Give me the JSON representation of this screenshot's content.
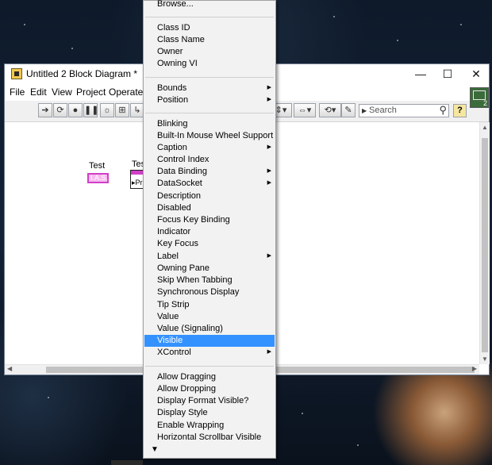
{
  "window": {
    "title": "Untitled 2 Block Diagram *",
    "controls": {
      "minimize": "—",
      "maximize": "☐",
      "close": "✕"
    }
  },
  "menubar": [
    "File",
    "Edit",
    "View",
    "Project",
    "Operate"
  ],
  "toolbar": {
    "search_placeholder": "Search",
    "help_label": "?",
    "vi_icon_number": "2"
  },
  "diagram": {
    "node1_label": "Test",
    "node1_ref_text": "I.A.S.",
    "node2_label": "Tes",
    "node2_prop_text": "▸Pr"
  },
  "context_menu": {
    "top_item": "Browse...",
    "group1": [
      "Class ID",
      "Class Name",
      "Owner",
      "Owning VI"
    ],
    "group2": [
      {
        "label": "Bounds",
        "submenu": true
      },
      {
        "label": "Position",
        "submenu": true
      }
    ],
    "group3": [
      {
        "label": "Blinking",
        "submenu": false
      },
      {
        "label": "Built-In Mouse Wheel Support",
        "submenu": false
      },
      {
        "label": "Caption",
        "submenu": true
      },
      {
        "label": "Control Index",
        "submenu": false
      },
      {
        "label": "Data Binding",
        "submenu": true
      },
      {
        "label": "DataSocket",
        "submenu": true
      },
      {
        "label": "Description",
        "submenu": false
      },
      {
        "label": "Disabled",
        "submenu": false
      },
      {
        "label": "Focus Key Binding",
        "submenu": false
      },
      {
        "label": "Indicator",
        "submenu": false
      },
      {
        "label": "Key Focus",
        "submenu": false
      },
      {
        "label": "Label",
        "submenu": true
      },
      {
        "label": "Owning Pane",
        "submenu": false
      },
      {
        "label": "Skip When Tabbing",
        "submenu": false
      },
      {
        "label": "Synchronous Display",
        "submenu": false
      },
      {
        "label": "Tip Strip",
        "submenu": false
      },
      {
        "label": "Value",
        "submenu": false
      },
      {
        "label": "Value (Signaling)",
        "submenu": false
      },
      {
        "label": "Visible",
        "submenu": false,
        "selected": true
      },
      {
        "label": "XControl",
        "submenu": true
      }
    ],
    "group4": [
      "Allow Dragging",
      "Allow Dropping",
      "Display Format Visible?",
      "Display Style",
      "Enable Wrapping",
      "Horizontal Scrollbar Visible"
    ],
    "more_arrow": "▼",
    "selected_color": "#3392ff"
  }
}
